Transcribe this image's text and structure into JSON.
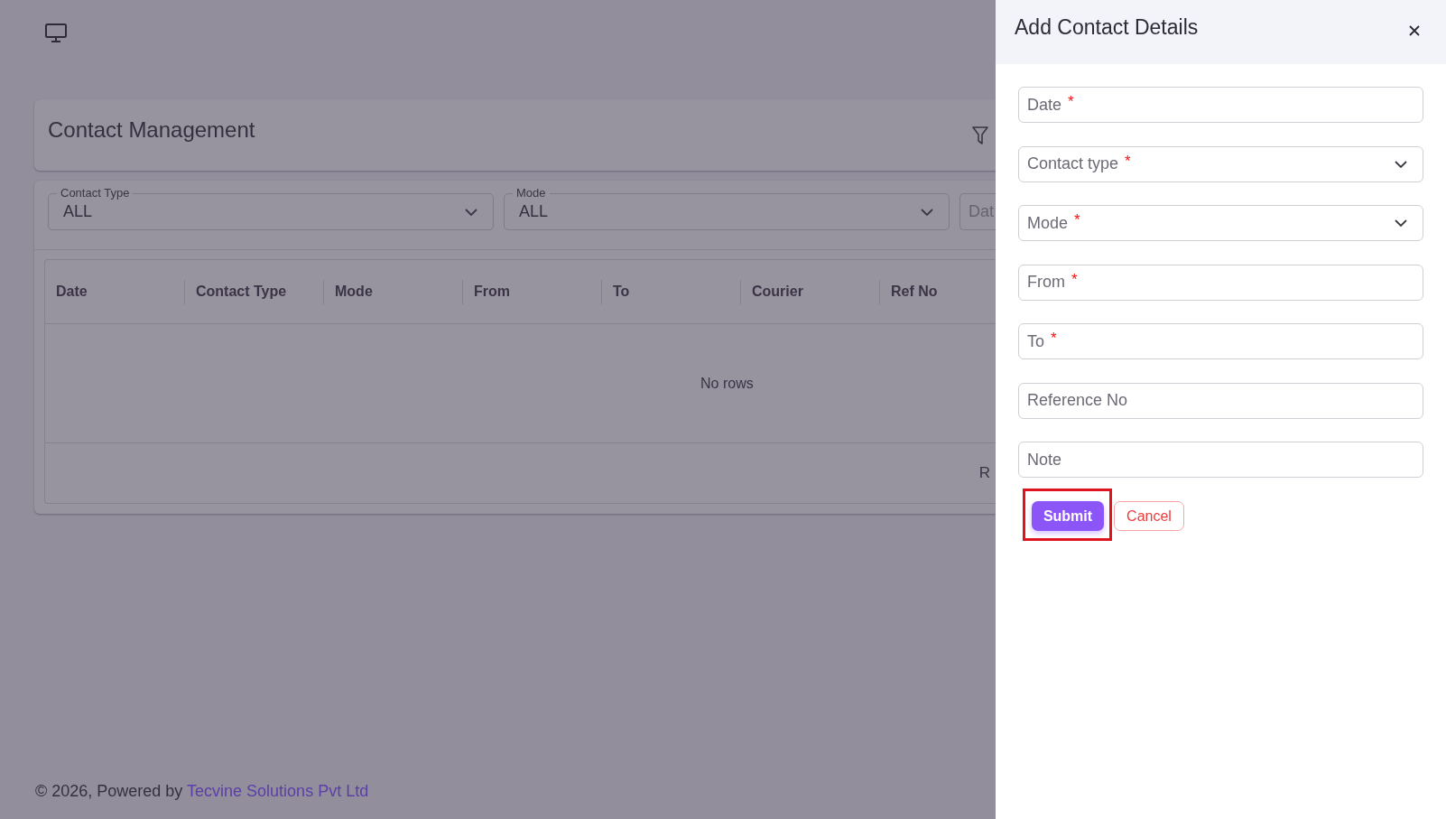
{
  "page": {
    "title": "Contact Management"
  },
  "filters": [
    {
      "kind": "select",
      "label": "Contact Type",
      "value": "ALL"
    },
    {
      "kind": "select",
      "label": "Mode",
      "value": "ALL"
    },
    {
      "kind": "text",
      "placeholder": "Dat"
    }
  ],
  "table": {
    "columns": [
      "Date",
      "Contact Type",
      "Mode",
      "From",
      "To",
      "Courier",
      "Ref No"
    ],
    "empty_message": "No rows",
    "footer_text": "R"
  },
  "footer": {
    "text": "© 2026, Powered by",
    "link": "Tecvine Solutions Pvt Ltd"
  },
  "drawer": {
    "title": "Add Contact Details",
    "fields": [
      {
        "kind": "text",
        "label": "Date",
        "required_mark": "*"
      },
      {
        "kind": "select",
        "label": "Contact type",
        "required_mark": "*"
      },
      {
        "kind": "select",
        "label": "Mode",
        "required_mark": "*"
      },
      {
        "kind": "text",
        "label": "From",
        "required_mark": "*"
      },
      {
        "kind": "text",
        "label": "To",
        "required_mark": "*"
      },
      {
        "kind": "text",
        "label": "Reference No"
      },
      {
        "kind": "text",
        "label": "Note"
      }
    ],
    "buttons": [
      {
        "kind": "primary",
        "label": "Submit",
        "highlighted": true
      },
      {
        "kind": "outline",
        "label": "Cancel",
        "highlighted": false
      }
    ]
  }
}
